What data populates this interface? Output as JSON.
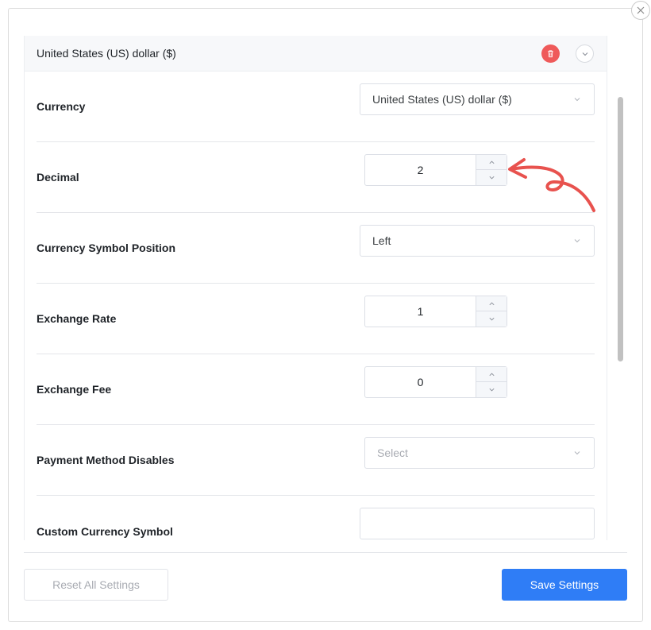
{
  "panel": {
    "title": "United States (US) dollar ($)"
  },
  "fields": {
    "currency": {
      "label": "Currency",
      "value": "United States (US) dollar ($)"
    },
    "decimal": {
      "label": "Decimal",
      "value": "2"
    },
    "symbol_position": {
      "label": "Currency Symbol Position",
      "value": "Left"
    },
    "exchange_rate": {
      "label": "Exchange Rate",
      "value": "1"
    },
    "exchange_fee": {
      "label": "Exchange Fee",
      "value": "0"
    },
    "payment_method_disables": {
      "label": "Payment Method Disables",
      "placeholder": "Select"
    },
    "custom_symbol": {
      "label": "Custom Currency Symbol",
      "value": ""
    }
  },
  "footer": {
    "reset_label": "Reset All Settings",
    "save_label": "Save Settings"
  },
  "icons": {
    "close": "close-icon",
    "trash": "trash-icon",
    "collapse": "chevron-down-icon",
    "annotation": "red-hand-drawn-arrow"
  },
  "colors": {
    "primary": "#2f7df6",
    "danger": "#ef5a5a",
    "annotation": "#e8524e"
  }
}
